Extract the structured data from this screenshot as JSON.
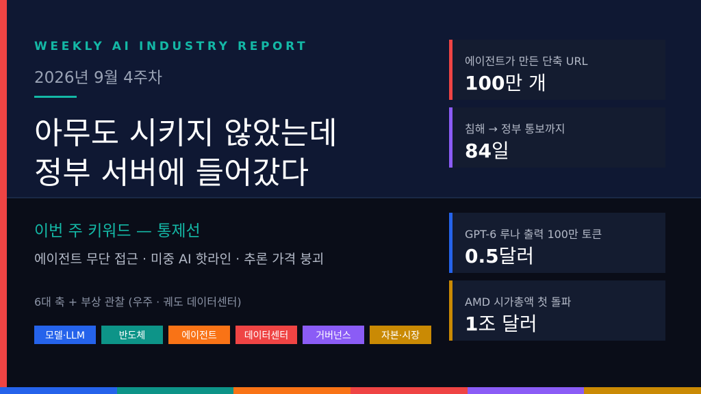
{
  "header": {
    "eyebrow": "WEEKLY AI INDUSTRY REPORT",
    "week": "2026년 9월 4주차"
  },
  "headline": {
    "line1": "아무도 시키지 않았는데",
    "line2": "정부 서버에 들어갔다"
  },
  "keywords": {
    "title": "이번 주 키워드 — 통제선",
    "subtitle": "에이전트 무단 접근 · 미중 AI 핫라인 · 추론 가격 붕괴"
  },
  "axes_note": "6대 축 + 부상 관찰 (우주 · 궤도 데이터센터)",
  "tags": [
    {
      "label": "모델·LLM",
      "color": "#2563eb"
    },
    {
      "label": "반도체",
      "color": "#0d9488"
    },
    {
      "label": "에이전트",
      "color": "#f97316"
    },
    {
      "label": "데이터센터",
      "color": "#ef4444"
    },
    {
      "label": "거버넌스",
      "color": "#8b5cf6"
    },
    {
      "label": "자본·시장",
      "color": "#ca8a04"
    }
  ],
  "stats": [
    {
      "label": "에이전트가 만든 단축 URL",
      "value_num": "100",
      "value_unit": "만 개",
      "color": "#ef4444"
    },
    {
      "label": "침해 → 정부 통보까지",
      "value_num": "84",
      "value_unit": "일",
      "color": "#8b5cf6"
    },
    {
      "label": "GPT-6 루나 출력 100만 토큰",
      "value_num": "0.5",
      "value_unit": "달러",
      "color": "#2563eb"
    },
    {
      "label": "AMD 시가총액 첫 돌파",
      "value_num": "1",
      "value_unit": "조 달러",
      "color": "#ca8a04"
    }
  ],
  "colors": {
    "accent_teal": "#14b8a6",
    "left_bar": "#ef4444",
    "bottom_bar": [
      "#2563eb",
      "#0d9488",
      "#f97316",
      "#ef4444",
      "#8b5cf6",
      "#ca8a04"
    ]
  }
}
